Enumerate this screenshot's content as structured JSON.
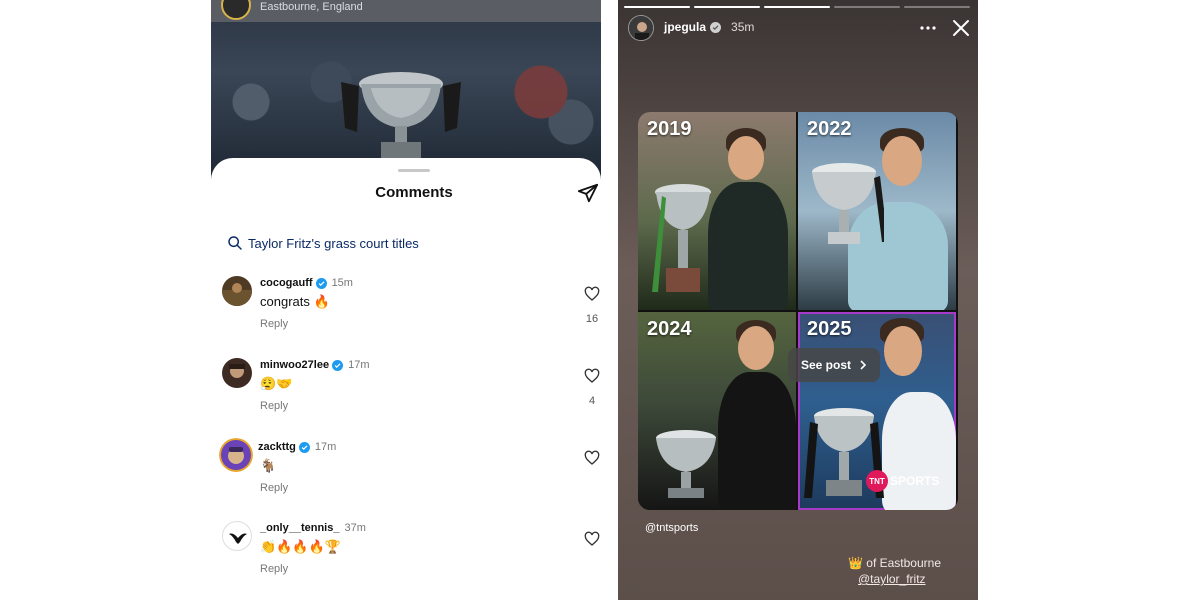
{
  "left": {
    "header_location": "Eastbourne, England",
    "sheet_title": "Comments",
    "search_suggestion": "Taylor Fritz's grass court titles",
    "comments": [
      {
        "username": "cocogauff",
        "time": "15m",
        "text": "congrats 🔥",
        "reply": "Reply",
        "likes": "16"
      },
      {
        "username": "minwoo27lee",
        "time": "17m",
        "text": "😮‍💨🤝",
        "reply": "Reply",
        "likes": "4"
      },
      {
        "username": "zackttg",
        "time": "17m",
        "text": "🐐",
        "reply": "Reply",
        "likes": ""
      },
      {
        "username": "_only__tennis_",
        "time": "37m",
        "text": "👏🔥🔥🔥🏆",
        "reply": "Reply",
        "likes": ""
      }
    ]
  },
  "story": {
    "username": "jpegula",
    "time": "35m",
    "progress_segments": 5,
    "progress_done": 3,
    "years": [
      "2019",
      "2022",
      "2024",
      "2025"
    ],
    "see_post": "See post",
    "brand_logo_text": "TNT",
    "brand_name": "SPORTS",
    "mention_tnt": "@tntsports",
    "caption": "👑 of Eastbourne",
    "mention_fritz": "@taylor_fritz"
  },
  "colors": {
    "verified": "#1d9bf0",
    "link_blue": "#0a2a66",
    "story_bg": "#5c4f4a",
    "tnt_pink": "#e0195a",
    "highlight_purple": "#a63bc9"
  }
}
